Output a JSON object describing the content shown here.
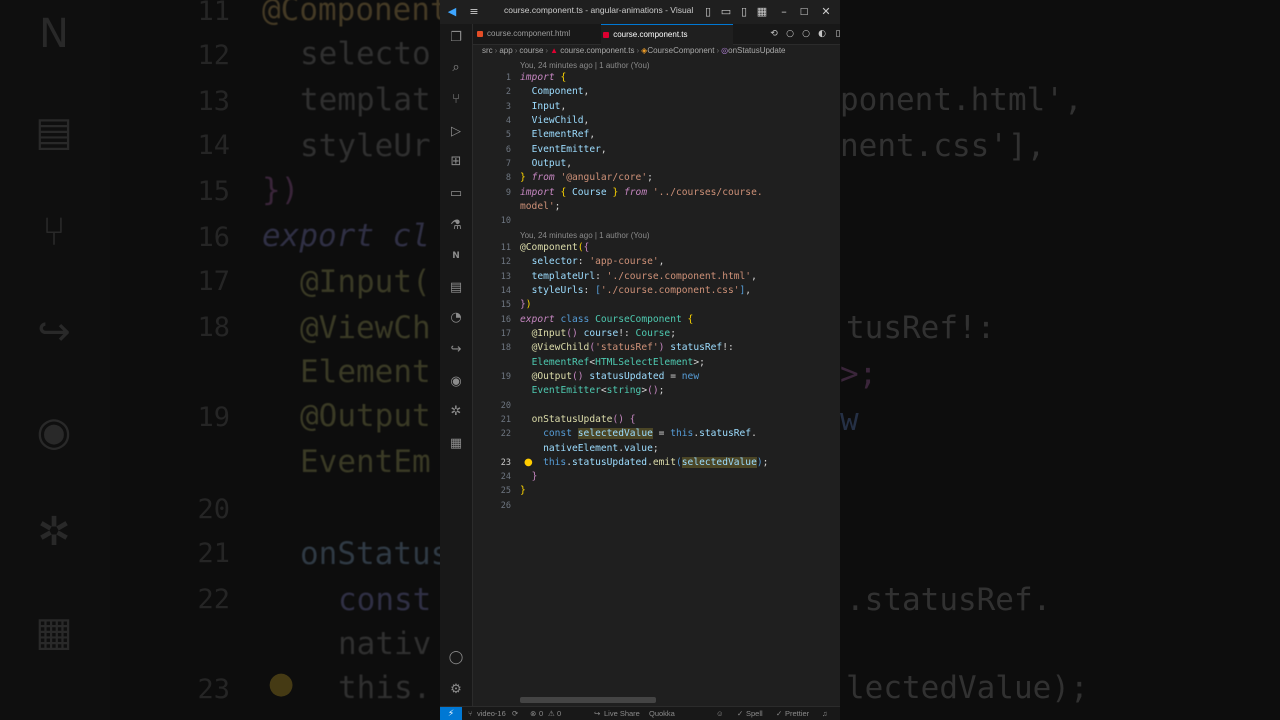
{
  "window": {
    "title": "course.component.ts - angular-animations - Visual ..."
  },
  "tabs": [
    {
      "label": "course.component.html",
      "color": "#e44d26"
    },
    {
      "label": "course.component.ts",
      "color": "#dd0031"
    }
  ],
  "breadcrumb": {
    "parts": [
      "src",
      "app",
      "course",
      "course.component.ts",
      "CourseComponent",
      "onStatusUpdate"
    ]
  },
  "editor": {
    "codelens1": "You, 24 minutes ago | 1 author (You)",
    "codelens2": "You, 24 minutes ago | 1 author (You)",
    "line_numbers": [
      "1",
      "2",
      "3",
      "4",
      "5",
      "6",
      "7",
      "8",
      "9",
      "",
      "10",
      "11",
      "12",
      "13",
      "14",
      "15",
      "16",
      "17",
      "18",
      "",
      "19",
      "",
      "20",
      "21",
      "22",
      "",
      "23",
      "24",
      "25",
      "26"
    ],
    "active_line": "23"
  },
  "statusbar": {
    "branch": "video-16",
    "problems": "0",
    "warnings": "0",
    "live_share": "Live Share",
    "quokka": "Quokka",
    "spell": "Spell",
    "prettier": "Prettier"
  },
  "background_code": {
    "lines": [
      "@Component",
      "selecto",
      "templat",
      "styleUr",
      "})",
      "export cl",
      "@Input(",
      "@ViewCh",
      "Element",
      "@Output",
      "EventEm",
      "",
      "onStatus",
      "const",
      "nativ",
      "this."
    ],
    "numbers": [
      "11",
      "12",
      "13",
      "14",
      "15",
      "16",
      "17",
      "18",
      "",
      "19",
      "",
      "20",
      "21",
      "22",
      "",
      "23"
    ],
    "right": [
      "ponent.html',",
      "nent.css'],",
      "tusRef!:",
      ">;",
      "w",
      ".statusRef.",
      "lectedValue);"
    ]
  }
}
